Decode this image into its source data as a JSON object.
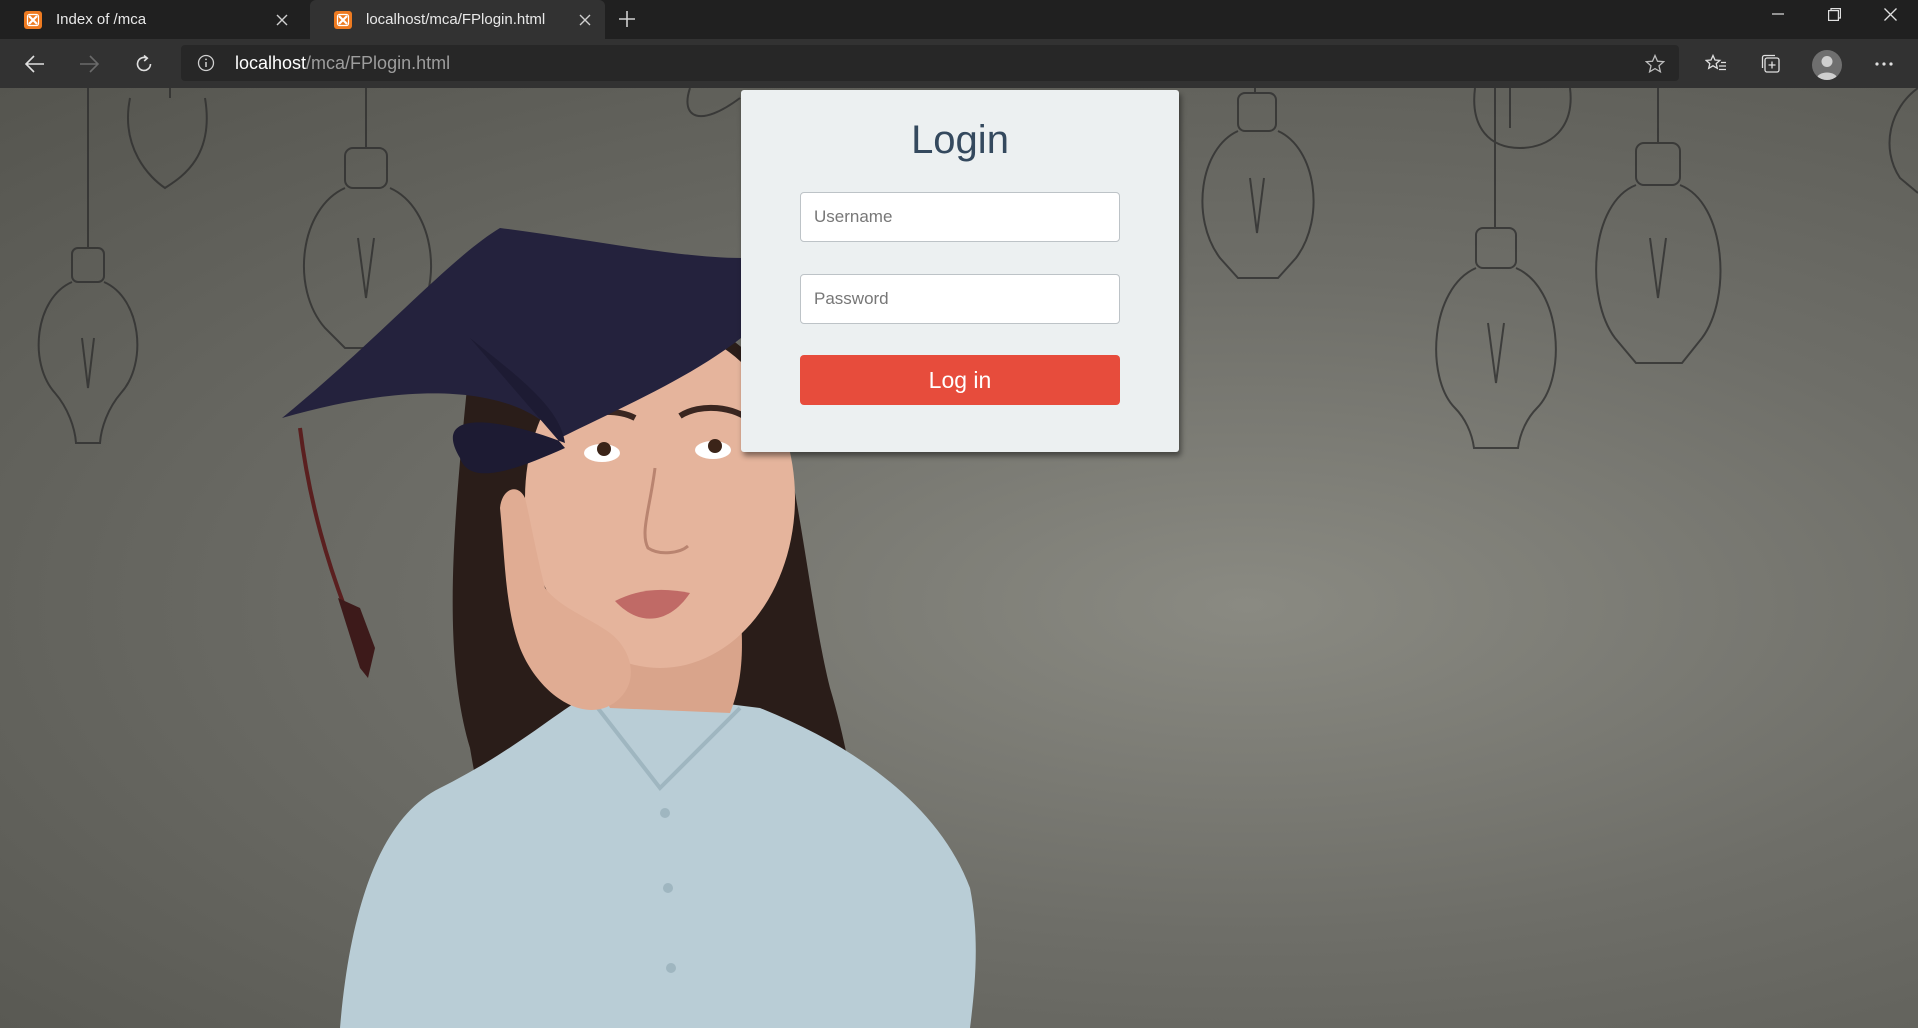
{
  "browser": {
    "tabs": [
      {
        "title": "Index of /mca",
        "active": false
      },
      {
        "title": "localhost/mca/FPlogin.html",
        "active": true
      }
    ],
    "address": {
      "host": "localhost",
      "path": "/mca/FPlogin.html"
    }
  },
  "login": {
    "title": "Login",
    "username_placeholder": "Username",
    "password_placeholder": "Password",
    "submit_label": "Log in"
  },
  "colors": {
    "card_bg": "#ecf0f1",
    "title_color": "#34495e",
    "button_bg": "#e74c3c",
    "favicon_orange": "#ee7b21"
  }
}
